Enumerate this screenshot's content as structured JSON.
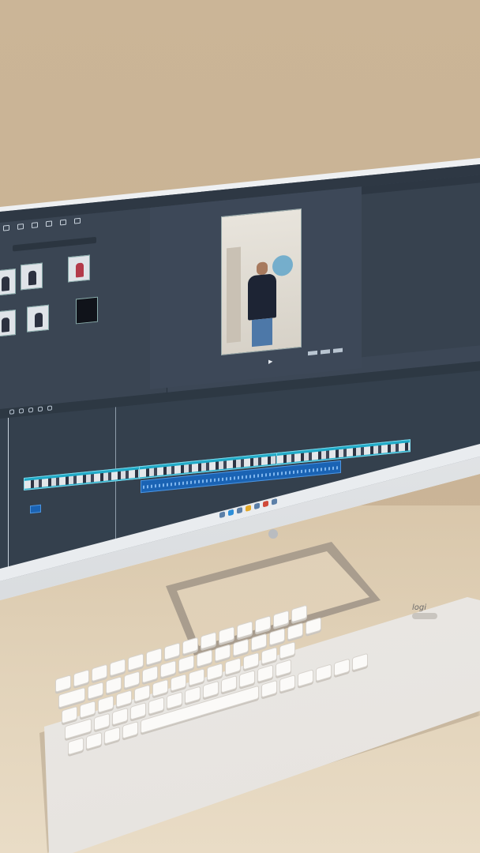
{
  "scene": {
    "description_labels": {
      "app_title": "",
      "media_tabs": [
        "",
        "",
        "",
        "",
        "",
        ""
      ],
      "media_search_placeholder": "",
      "preview_title": "",
      "props_header": "",
      "keyboard_brand": "logi"
    }
  },
  "colors": {
    "accent": "#1faac7",
    "audio": "#1a63b4",
    "panel": "#3a4553",
    "wall": "#c9b394"
  },
  "icons": [
    "search-icon",
    "media-icon",
    "play-icon",
    "cut-icon",
    "settings-icon"
  ]
}
